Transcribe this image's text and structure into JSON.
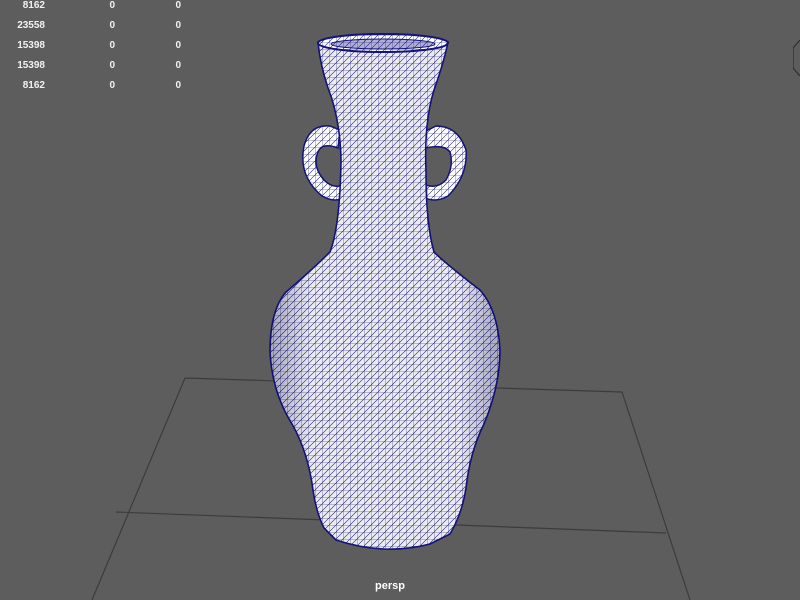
{
  "viewport": {
    "camera": "persp",
    "background_color": "#5d5d5d",
    "wireframe_color": "#13137a",
    "grid_color": "#3c3c3c"
  },
  "hud": {
    "rows": [
      [
        "8162",
        "0",
        "0"
      ],
      [
        "23558",
        "0",
        "0"
      ],
      [
        "15398",
        "0",
        "0"
      ],
      [
        "15398",
        "0",
        "0"
      ],
      [
        "8162",
        "0",
        "0"
      ]
    ]
  },
  "scene": {
    "object": "vase-wireframe-mesh",
    "grid": true
  }
}
